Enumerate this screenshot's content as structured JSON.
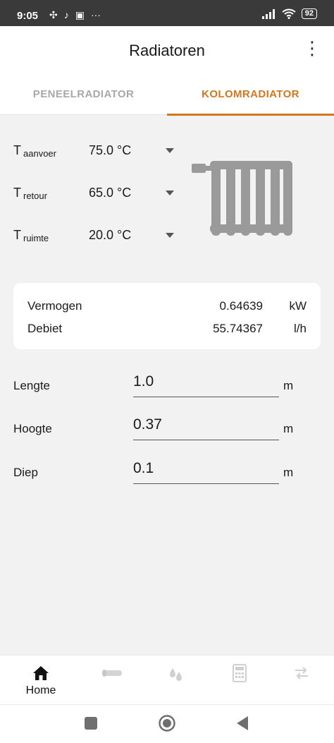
{
  "status_bar": {
    "time": "9:05",
    "battery": "92",
    "icons": [
      "fan-icon",
      "tiktok-icon",
      "calendar-icon",
      "more-dots-icon",
      "signal-icon",
      "wifi-icon",
      "battery-icon"
    ]
  },
  "app_bar": {
    "title": "Radiatoren",
    "menu_icon": "overflow-menu-icon"
  },
  "tabs": [
    {
      "label": "PENEELRADIATOR",
      "active": false
    },
    {
      "label": "KOLOMRADIATOR",
      "active": true
    }
  ],
  "temperatures": [
    {
      "label": "T",
      "sub": "aanvoer",
      "value": "75.0 °C"
    },
    {
      "label": "T",
      "sub": "retour",
      "value": "65.0 °C"
    },
    {
      "label": "T",
      "sub": "ruimte",
      "value": "20.0 °C"
    }
  ],
  "results": [
    {
      "name": "Vermogen",
      "value": "0.64639",
      "unit": "kW"
    },
    {
      "name": "Debiet",
      "value": "55.74367",
      "unit": "l/h"
    }
  ],
  "dimensions": [
    {
      "label": "Lengte",
      "value": "1.0",
      "unit": "m"
    },
    {
      "label": "Hoogte",
      "value": "0.37",
      "unit": "m"
    },
    {
      "label": "Diep",
      "value": "0.1",
      "unit": "m"
    }
  ],
  "bottom_nav": [
    {
      "label": "Home",
      "icon": "home-icon",
      "active": true
    },
    {
      "label": "",
      "icon": "pipe-icon",
      "active": false
    },
    {
      "label": "",
      "icon": "drops-icon",
      "active": false
    },
    {
      "label": "",
      "icon": "calculator-icon",
      "active": false
    },
    {
      "label": "",
      "icon": "swap-arrows-icon",
      "active": false
    }
  ],
  "colors": {
    "accent": "#d3771c",
    "background": "#f2f2f2",
    "inactive_icon": "#cfcfcf",
    "radiator": "#9a9a9a"
  }
}
